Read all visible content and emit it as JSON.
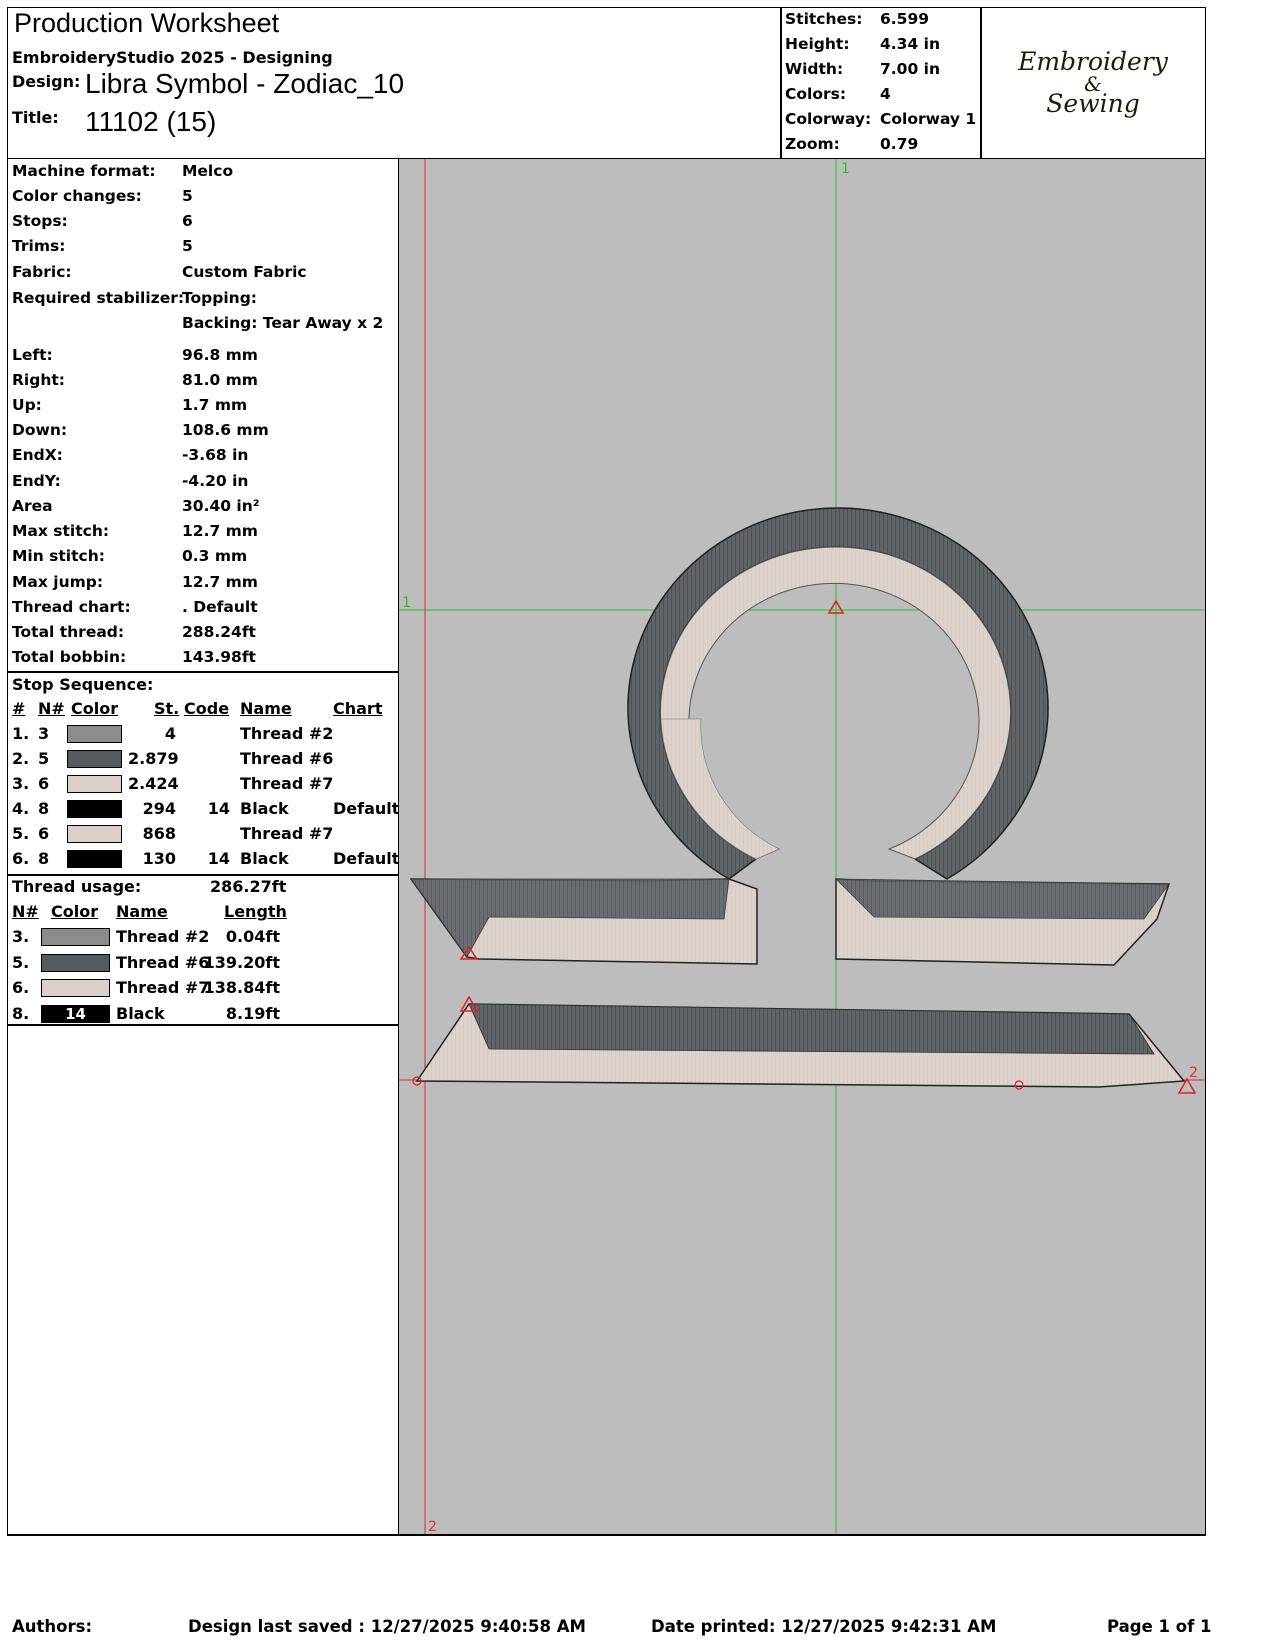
{
  "header": {
    "title": "Production Worksheet",
    "software": "EmbroideryStudio 2025 - Designing",
    "design_label": "Design:",
    "design_value": "Libra Symbol - Zodiac_10",
    "title_label": "Title:",
    "title_value": "11102 (15)"
  },
  "summary": [
    {
      "label": "Stitches:",
      "value": "6.599"
    },
    {
      "label": "Height:",
      "value": "4.34 in"
    },
    {
      "label": "Width:",
      "value": "7.00 in"
    },
    {
      "label": "Colors:",
      "value": "4"
    },
    {
      "label": "Colorway:",
      "value": "Colorway 1"
    },
    {
      "label": "Zoom:",
      "value": "0.79"
    }
  ],
  "logo": {
    "line1": "Embroidery",
    "line2": "&",
    "line3": "Sewing"
  },
  "details": [
    {
      "label": "Machine format:",
      "value": "Melco"
    },
    {
      "label": "Color changes:",
      "value": "5"
    },
    {
      "label": "Stops:",
      "value": "6"
    },
    {
      "label": "Trims:",
      "value": "5"
    },
    {
      "label": "Fabric:",
      "value": "Custom Fabric"
    },
    {
      "label": "Required stabilizer:",
      "value": "Topping:"
    },
    {
      "label": "",
      "value": "Backing: Tear Away x 2"
    },
    {
      "label": "Left:",
      "value": "96.8 mm"
    },
    {
      "label": "Right:",
      "value": "81.0 mm"
    },
    {
      "label": "Up:",
      "value": "1.7 mm"
    },
    {
      "label": "Down:",
      "value": "108.6 mm"
    },
    {
      "label": "EndX:",
      "value": "-3.68 in"
    },
    {
      "label": "EndY:",
      "value": "-4.20 in"
    },
    {
      "label": "Area",
      "value": " 30.40 in²"
    },
    {
      "label": "Max stitch:",
      "value": "12.7 mm"
    },
    {
      "label": "Min stitch:",
      "value": "0.3 mm"
    },
    {
      "label": "Max jump:",
      "value": "12.7 mm"
    },
    {
      "label": "Thread chart:",
      "value": ". Default"
    },
    {
      "label": "Total thread:",
      "value": "288.24ft"
    },
    {
      "label": "Total bobbin:",
      "value": "143.98ft"
    }
  ],
  "stop_sequence": {
    "title": "Stop Sequence:",
    "headers": {
      "num": "#",
      "n": "N#",
      "color": "Color",
      "st": "St.",
      "code": "Code",
      "name": "Name",
      "chart": "Chart"
    },
    "rows": [
      {
        "num": "1.",
        "n": "3",
        "color": "#8c8c8c",
        "st": "4",
        "code": "",
        "name": "Thread #2",
        "chart": ""
      },
      {
        "num": "2.",
        "n": "5",
        "color": "#555a5d",
        "st": "2.879",
        "code": "",
        "name": "Thread #6",
        "chart": ""
      },
      {
        "num": "3.",
        "n": "6",
        "color": "#dbd0c9",
        "st": "2.424",
        "code": "",
        "name": "Thread #7",
        "chart": ""
      },
      {
        "num": "4.",
        "n": "8",
        "color": "#000000",
        "st": "294",
        "code": "14",
        "name": "Black",
        "chart": "Default"
      },
      {
        "num": "5.",
        "n": "6",
        "color": "#dbd0c9",
        "st": "868",
        "code": "",
        "name": "Thread #7",
        "chart": ""
      },
      {
        "num": "6.",
        "n": "8",
        "color": "#000000",
        "st": "130",
        "code": "14",
        "name": "Black",
        "chart": "Default"
      }
    ]
  },
  "thread_usage": {
    "title": "Thread usage:",
    "total": "286.27ft",
    "headers": {
      "n": "N#",
      "color": "Color",
      "name": "Name",
      "length": "Length"
    },
    "rows": [
      {
        "n": "3.",
        "color": "#8c8c8c",
        "code": "",
        "name": "Thread #2",
        "length": "0.04ft"
      },
      {
        "n": "5.",
        "color": "#555a5d",
        "code": "",
        "name": "Thread #6",
        "length": "139.20ft"
      },
      {
        "n": "6.",
        "color": "#dbd0c9",
        "code": "",
        "name": "Thread #7",
        "length": "138.84ft"
      },
      {
        "n": "8.",
        "color": "#000000",
        "code": "14",
        "name": "Black",
        "length": "8.19ft"
      }
    ]
  },
  "preview": {
    "background": "#bdbdbd",
    "guide_v1": "1",
    "guide_h1": "1",
    "guide_v2": "2",
    "guide_h2": "2"
  },
  "footer": {
    "authors": "Authors:",
    "saved": "Design last saved : 12/27/2025 9:40:58 AM",
    "printed": "Date printed: 12/27/2025 9:42:31 AM",
    "page": "Page 1 of 1"
  }
}
